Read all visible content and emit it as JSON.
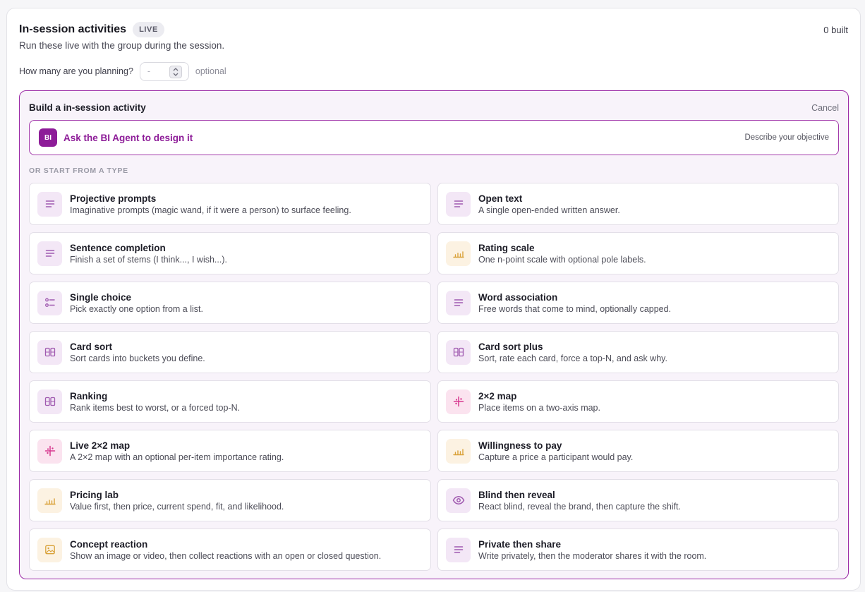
{
  "header": {
    "title": "In-session activities",
    "badge": "LIVE",
    "built_count": "0 built",
    "subtitle": "Run these live with the group during the session."
  },
  "planning": {
    "label": "How many are you planning?",
    "placeholder": "-",
    "optional": "optional"
  },
  "builder": {
    "title": "Build a in-session activity",
    "cancel": "Cancel",
    "agent": {
      "logo": "BI",
      "label": "Ask the BI Agent to design it",
      "hint": "Describe your objective"
    },
    "section_label": "OR START FROM A TYPE"
  },
  "activity_types": [
    {
      "title": "Projective prompts",
      "desc": "Imaginative prompts (magic wand, if it were a person) to surface feeling.",
      "icon": "lines-icon",
      "tone": "purple"
    },
    {
      "title": "Open text",
      "desc": "A single open-ended written answer.",
      "icon": "lines-icon",
      "tone": "purple"
    },
    {
      "title": "Sentence completion",
      "desc": "Finish a set of stems (I think..., I wish...).",
      "icon": "lines-icon",
      "tone": "purple"
    },
    {
      "title": "Rating scale",
      "desc": "One n-point scale with optional pole labels.",
      "icon": "bars-icon",
      "tone": "amber"
    },
    {
      "title": "Single choice",
      "desc": "Pick exactly one option from a list.",
      "icon": "list-choice-icon",
      "tone": "purple"
    },
    {
      "title": "Word association",
      "desc": "Free words that come to mind, optionally capped.",
      "icon": "lines-icon",
      "tone": "purple"
    },
    {
      "title": "Card sort",
      "desc": "Sort cards into buckets you define.",
      "icon": "cards-icon",
      "tone": "purple"
    },
    {
      "title": "Card sort plus",
      "desc": "Sort, rate each card, force a top-N, and ask why.",
      "icon": "cards-icon",
      "tone": "purple"
    },
    {
      "title": "Ranking",
      "desc": "Rank items best to worst, or a forced top-N.",
      "icon": "cards-icon",
      "tone": "purple"
    },
    {
      "title": "2×2 map",
      "desc": "Place items on a two-axis map.",
      "icon": "axis-map-icon",
      "tone": "pink"
    },
    {
      "title": "Live 2×2 map",
      "desc": "A 2×2 map with an optional per-item importance rating.",
      "icon": "axis-map-icon",
      "tone": "pink"
    },
    {
      "title": "Willingness to pay",
      "desc": "Capture a price a participant would pay.",
      "icon": "bars-icon",
      "tone": "amber"
    },
    {
      "title": "Pricing lab",
      "desc": "Value first, then price, current spend, fit, and likelihood.",
      "icon": "bars-icon",
      "tone": "amber"
    },
    {
      "title": "Blind then reveal",
      "desc": "React blind, reveal the brand, then capture the shift.",
      "icon": "eye-icon",
      "tone": "purple"
    },
    {
      "title": "Concept reaction",
      "desc": "Show an image or video, then collect reactions with an open or closed question.",
      "icon": "image-icon",
      "tone": "amber"
    },
    {
      "title": "Private then share",
      "desc": "Write privately, then the moderator shares it with the room.",
      "icon": "lines-icon",
      "tone": "purple"
    }
  ],
  "colors": {
    "accent": "#8d1c98",
    "icon_purple": "#a05ab0",
    "icon_amber": "#d9a23a",
    "icon_pink": "#d7388f"
  }
}
